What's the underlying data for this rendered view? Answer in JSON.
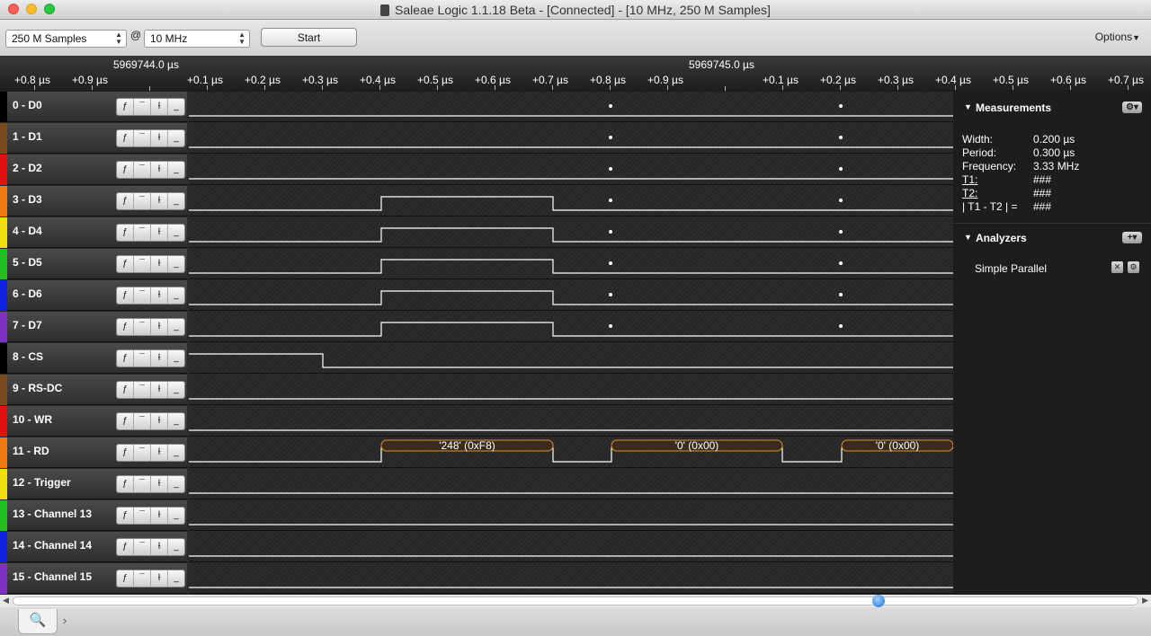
{
  "window": {
    "title": "Saleae Logic 1.1.18 Beta - [Connected] - [10 MHz, 250 M Samples]"
  },
  "toolbar": {
    "samples_value": "250 M Samples",
    "at_label": "@",
    "rate_value": "10 MHz",
    "start_label": "Start",
    "options_label": "Options",
    "options_icon": "triangle-down-icon"
  },
  "ruler": {
    "absolute_labels": [
      "5969744.0 µs",
      "5969745.0 µs"
    ],
    "ticks": [
      "+0.8 µs",
      "+0.9 µs",
      "+0.1 µs",
      "+0.2 µs",
      "+0.3 µs",
      "+0.4 µs",
      "+0.5 µs",
      "+0.6 µs",
      "+0.7 µs",
      "+0.8 µs",
      "+0.9 µs",
      "+0.1 µs",
      "+0.2 µs",
      "+0.3 µs",
      "+0.4 µs",
      "+0.5 µs",
      "+0.6 µs",
      "+0.7 µs"
    ]
  },
  "trigger_buttons": {
    "rising": "ƒ",
    "high": "¯",
    "falling": "Ɨ",
    "low": "_"
  },
  "channels": [
    {
      "name": "0 - D0",
      "color": "#000000"
    },
    {
      "name": "1 - D1",
      "color": "#7a4a1e"
    },
    {
      "name": "2 - D2",
      "color": "#e01010"
    },
    {
      "name": "3 - D3",
      "color": "#f07a10"
    },
    {
      "name": "4 - D4",
      "color": "#f0e010"
    },
    {
      "name": "5 - D5",
      "color": "#20c020"
    },
    {
      "name": "6 - D6",
      "color": "#1020e0"
    },
    {
      "name": "7 - D7",
      "color": "#8030c0"
    },
    {
      "name": "8 - CS",
      "color": "#000000"
    },
    {
      "name": "9 - RS-DC",
      "color": "#7a4a1e"
    },
    {
      "name": "10 - WR",
      "color": "#e01010"
    },
    {
      "name": "11 - RD",
      "color": "#f07a10"
    },
    {
      "name": "12 - Trigger",
      "color": "#f0e010"
    },
    {
      "name": "13 - Channel 13",
      "color": "#20c020"
    },
    {
      "name": "14 - Channel 14",
      "color": "#1020e0"
    },
    {
      "name": "15 - Channel 15",
      "color": "#8030c0"
    }
  ],
  "decoded": [
    {
      "label": "'248' (0xF8)"
    },
    {
      "label": "'0' (0x00)"
    },
    {
      "label": "'0' (0x00)"
    }
  ],
  "panel": {
    "measurements_title": "Measurements",
    "measurements": [
      {
        "key": "Width:",
        "value": "0.200 µs"
      },
      {
        "key": "Period:",
        "value": "0.300 µs"
      },
      {
        "key": "Frequency:",
        "value": "3.33 MHz"
      },
      {
        "key": "T1:",
        "value": "###"
      },
      {
        "key": "T2:",
        "value": "###"
      },
      {
        "key": "| T1 - T2 | =",
        "value": "###"
      }
    ],
    "analyzers_title": "Analyzers",
    "add_label": "+",
    "analyzer_items": [
      "Simple Parallel"
    ],
    "gear_icon": "gear-icon"
  },
  "colors": {
    "accent_blue": "#1e6fd6",
    "decode_border": "#e0902a"
  }
}
